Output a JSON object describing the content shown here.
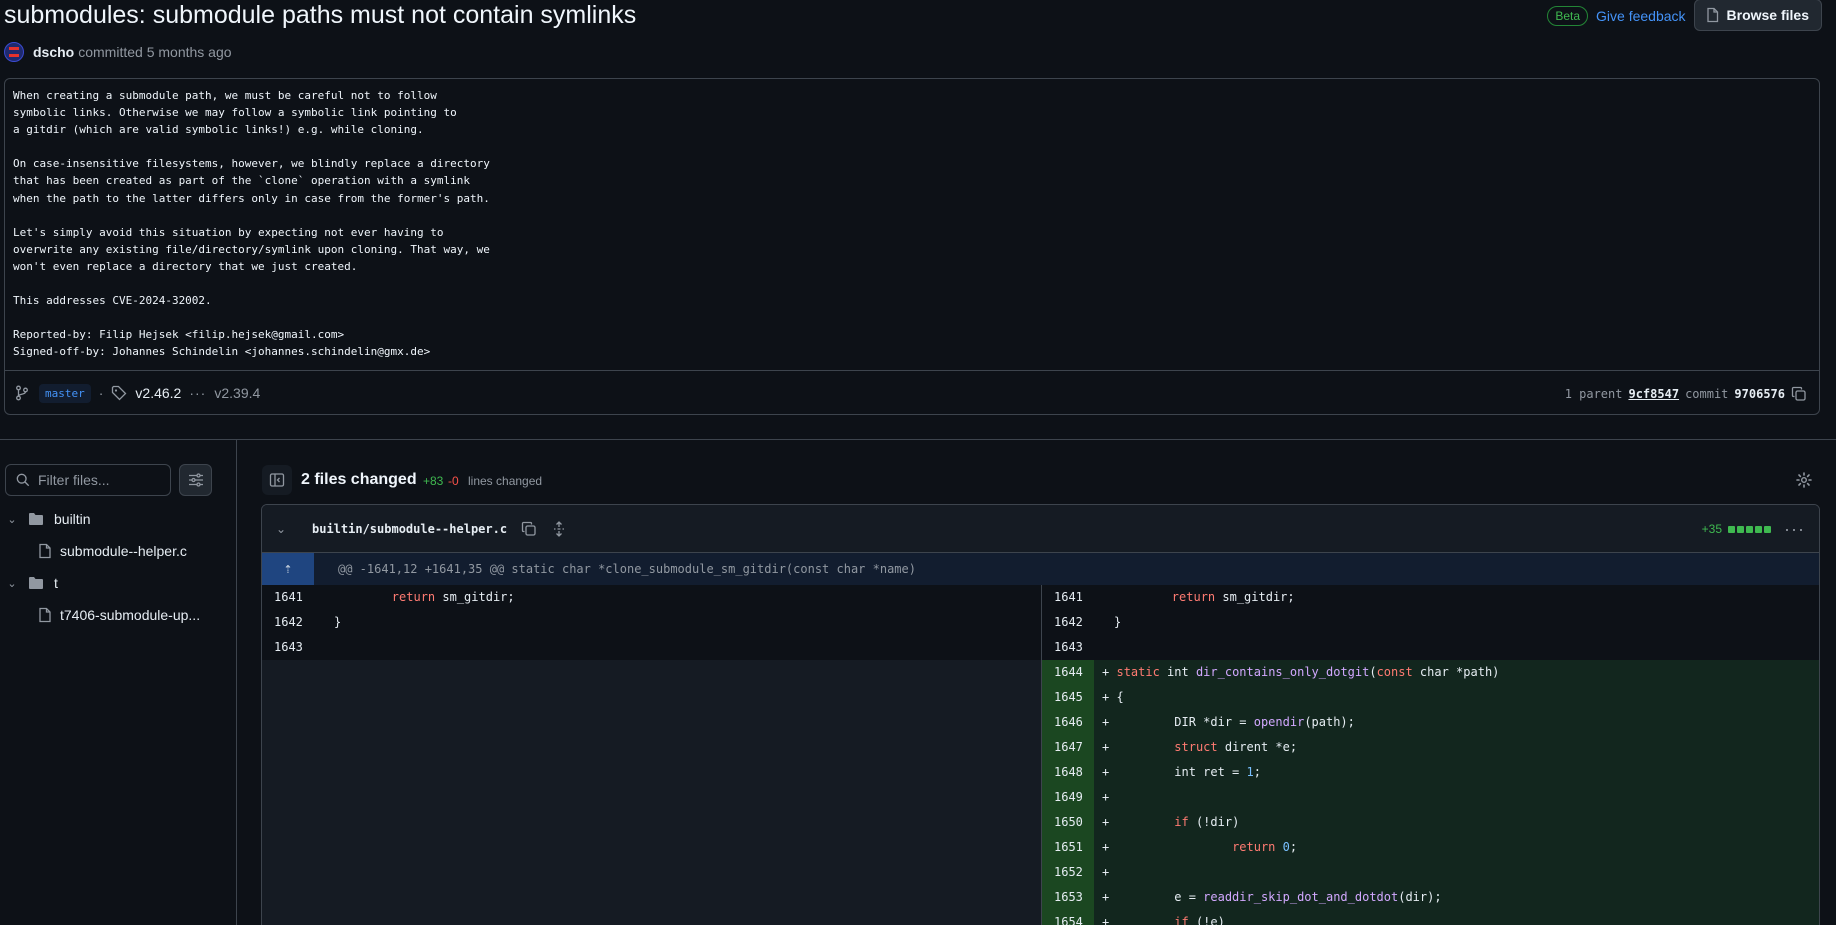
{
  "commit": {
    "title": "submodules: submodule paths must not contain symlinks",
    "author": "dscho",
    "committed_text": "committed 5 months ago",
    "message": "When creating a submodule path, we must be careful not to follow\nsymbolic links. Otherwise we may follow a symbolic link pointing to\na gitdir (which are valid symbolic links!) e.g. while cloning.\n\nOn case-insensitive filesystems, however, we blindly replace a directory\nthat has been created as part of the `clone` operation with a symlink\nwhen the path to the latter differs only in case from the former's path.\n\nLet's simply avoid this situation by expecting not ever having to\noverwrite any existing file/directory/symlink upon cloning. That way, we\nwon't even replace a directory that we just created.\n\nThis addresses CVE-2024-32002.\n\nReported-by: Filip Hejsek <filip.hejsek@gmail.com>\nSigned-off-by: Johannes Schindelin <johannes.schindelin@gmx.de>",
    "branch": "master",
    "tag_first": "v2.46.2",
    "tag_last": "v2.39.4",
    "parent_label": "1 parent",
    "parent_sha": "9cf8547",
    "commit_label": "commit",
    "commit_sha": "9706576"
  },
  "header": {
    "beta": "Beta",
    "feedback": "Give feedback",
    "browse": "Browse files"
  },
  "sidebar": {
    "filter_placeholder": "Filter files...",
    "tree": [
      {
        "name": "builtin",
        "type": "folder"
      },
      {
        "name": "submodule--helper.c",
        "type": "file"
      },
      {
        "name": "t",
        "type": "folder"
      },
      {
        "name": "t7406-submodule-up...",
        "type": "file"
      }
    ]
  },
  "diff": {
    "files_changed": "2 files changed",
    "additions": "+83",
    "deletions": "-0",
    "lines_changed": "lines changed",
    "file": {
      "path": "builtin/submodule--helper.c",
      "stat": "+35"
    },
    "hunk": "@@ -1641,12 +1641,35 @@ static char *clone_submodule_sm_gitdir(const char *name)",
    "left_lines": [
      "1641",
      "1642",
      "1643"
    ],
    "right_lines": [
      "1641",
      "1642",
      "1643",
      "1644",
      "1645",
      "1646",
      "1647",
      "1648",
      "1649",
      "1650",
      "1651",
      "1652",
      "1653",
      "1654"
    ]
  },
  "colors": {
    "background": "#0d1117",
    "addition": "#3fb950",
    "deletion": "#f85149",
    "link": "#4493f8"
  },
  "icons": [
    "avatar",
    "copy-icon",
    "branch-icon",
    "tag-icon",
    "search-icon",
    "filter-settings-icon",
    "folder-icon",
    "file-icon",
    "sidebar-collapse-icon",
    "gear-icon",
    "chevron-down-icon",
    "expand-icon",
    "kebab-icon",
    "browse-icon"
  ]
}
